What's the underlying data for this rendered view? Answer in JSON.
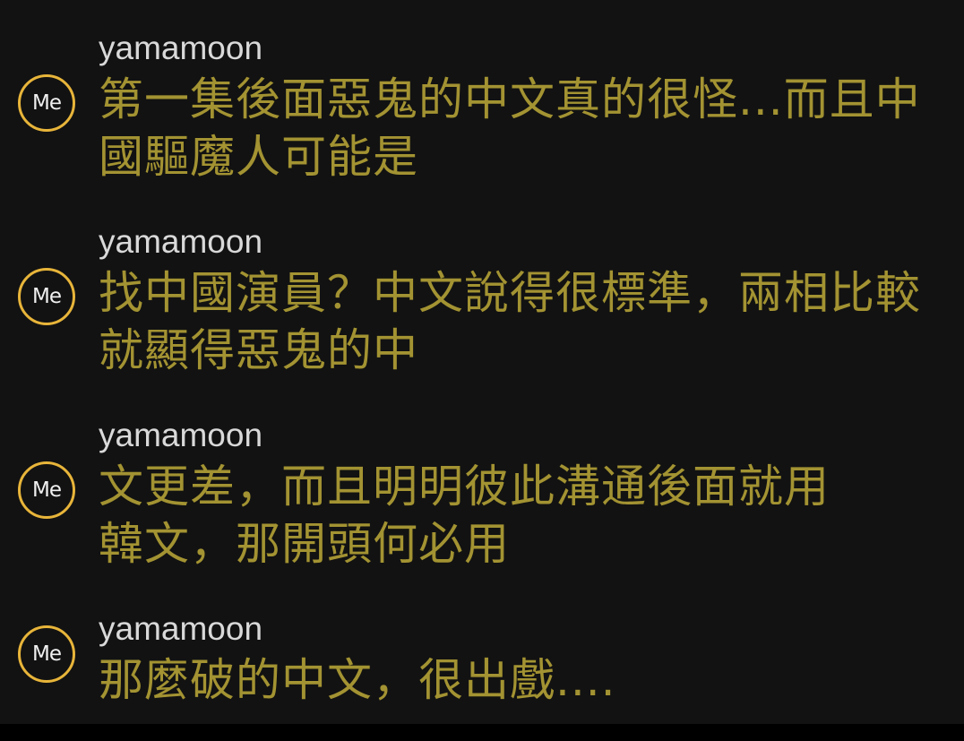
{
  "comments": [
    {
      "avatar": "Me",
      "username": "yamamoon",
      "lines": [
        "第一集後面惡鬼的中文真的很怪...而且中",
        "國驅魔人可能是"
      ]
    },
    {
      "avatar": "Me",
      "username": "yamamoon",
      "lines": [
        "找中國演員？中文說得很標準，兩相比較",
        "就顯得惡鬼的中"
      ]
    },
    {
      "avatar": "Me",
      "username": "yamamoon",
      "lines": [
        "文更差，而且明明彼此溝通後面就用",
        "韓文，那開頭何必用"
      ]
    },
    {
      "avatar": "Me",
      "username": "yamamoon",
      "lines": [
        "那麼破的中文，很出戲...."
      ]
    }
  ],
  "colors": {
    "background": "#121212",
    "username": "#d9d9d9",
    "message": "#a39332",
    "avatar_ring": "#e8b53a"
  }
}
